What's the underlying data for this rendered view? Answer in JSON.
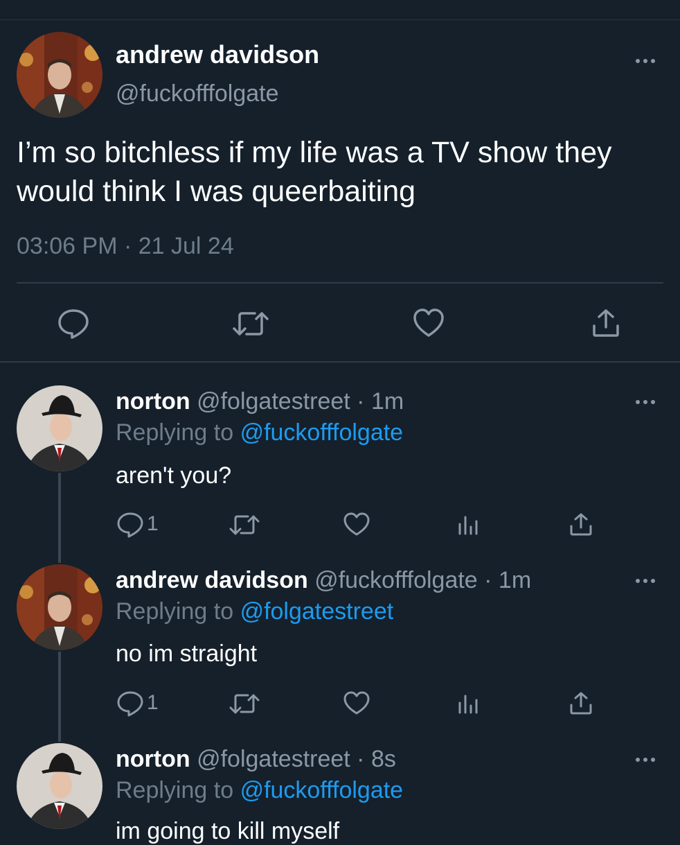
{
  "main_tweet": {
    "display_name": "andrew davidson",
    "handle": "@fuckofffolgate",
    "text": "I’m so bitchless if my life was a TV show they would think I was queerbaiting",
    "timestamp": "03:06 PM · 21 Jul 24",
    "more_icon": "more-dots-icon"
  },
  "replies": [
    {
      "display_name": "norton",
      "handle_time": "@folgatestreet · 1m",
      "replying_prefix": "Replying to",
      "replying_to": "@fuckofffolgate",
      "text": "aren't you?",
      "reply_count": "1"
    },
    {
      "display_name": "andrew davidson",
      "handle_time": "@fuckofffolgate · 1m",
      "replying_prefix": "Replying to",
      "replying_to": "@folgatestreet",
      "text": "no im straight",
      "reply_count": "1"
    },
    {
      "display_name": "norton",
      "handle_time": "@folgatestreet · 8s",
      "replying_prefix": "Replying to",
      "replying_to": "@fuckofffolgate",
      "text": "im going to kill myself"
    }
  ],
  "colors": {
    "background": "#15202b",
    "muted": "#8b98a5",
    "link": "#1d9bf0",
    "divider": "#2f3b46"
  }
}
